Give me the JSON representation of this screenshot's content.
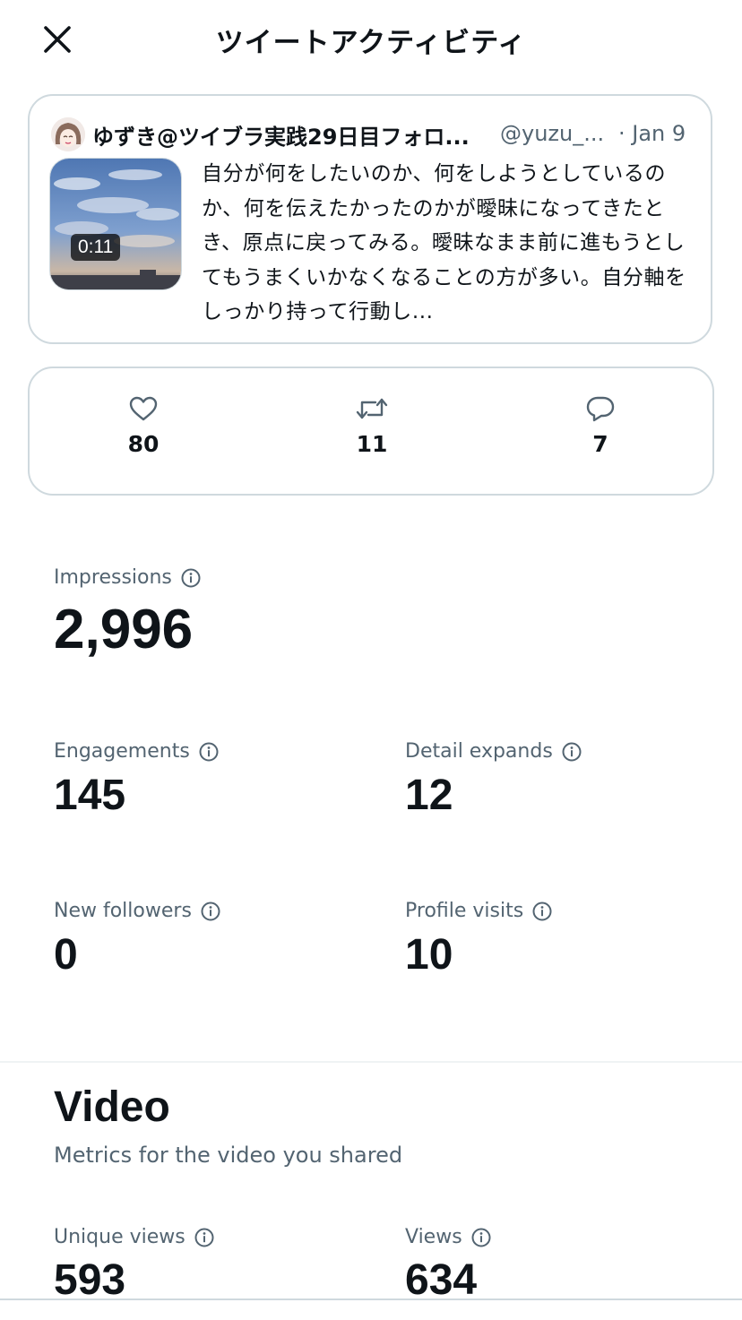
{
  "header": {
    "title": "ツイートアクティビティ",
    "close_icon": "close-icon"
  },
  "tweet": {
    "author_name": "ゆずき@ツイブラ実践29日目フォロ...",
    "handle": "@yuzu_...",
    "date": "· Jan 9",
    "video_duration": "0:11",
    "text": "自分が何をしたいのか、何をしようとしているのか、何を伝えたかったのかが曖昧になってきたとき、原点に戻ってみる。曖昧なまま前に進もうとしてもうまくいかなくなることの方が多い。自分軸をしっかり持って行動し..."
  },
  "engagement": {
    "likes": "80",
    "retweets": "11",
    "replies": "7"
  },
  "metrics": {
    "impressions_label": "Impressions",
    "impressions_value": "2,996",
    "engagements_label": "Engagements",
    "engagements_value": "145",
    "detail_expands_label": "Detail expands",
    "detail_expands_value": "12",
    "new_followers_label": "New followers",
    "new_followers_value": "0",
    "profile_visits_label": "Profile visits",
    "profile_visits_value": "10"
  },
  "video": {
    "title": "Video",
    "subtitle": "Metrics for the video you shared",
    "unique_views_label": "Unique views",
    "unique_views_value": "593",
    "views_label": "Views",
    "views_value": "634"
  }
}
